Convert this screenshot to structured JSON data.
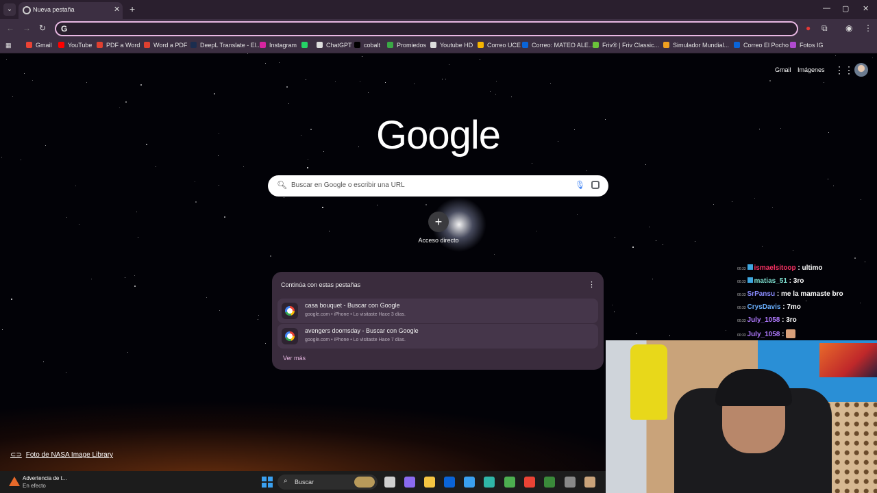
{
  "browser": {
    "tab_title": "Nueva pestaña",
    "tab_close": "✕",
    "new_tab": "+",
    "window_controls": [
      "—",
      "▢",
      "✕"
    ],
    "omnibox_value": ""
  },
  "bookmarks": [
    {
      "label": "Gmail",
      "color": "#ea4335"
    },
    {
      "label": "YouTube",
      "color": "#ff0000"
    },
    {
      "label": "PDF a Word",
      "color": "#e04030"
    },
    {
      "label": "Word a PDF",
      "color": "#e04030"
    },
    {
      "label": "DeepL Translate - El...",
      "color": "#1b2d4f"
    },
    {
      "label": "Instagram",
      "color": "#d6249f"
    },
    {
      "label": "",
      "color": "#25d366"
    },
    {
      "label": "ChatGPT",
      "color": "#dddddd"
    },
    {
      "label": "cobalt",
      "color": "#000000"
    },
    {
      "label": "Promiedos",
      "color": "#3aa845"
    },
    {
      "label": "Youtube HD",
      "color": "#dddddd"
    },
    {
      "label": "Correo UCE",
      "color": "#f5b400"
    },
    {
      "label": "Correo: MATEO ALE...",
      "color": "#0a64d8"
    },
    {
      "label": "Friv® | Friv Classic...",
      "color": "#6ac23a"
    },
    {
      "label": "Simulador Mundial...",
      "color": "#f0a020"
    },
    {
      "label": "Correo El Pocho",
      "color": "#0a64d8"
    },
    {
      "label": "Fotos IG",
      "color": "#b04ad0"
    }
  ],
  "ntp": {
    "top_links": {
      "gmail": "Gmail",
      "images": "Imágenes"
    },
    "logo": "Google",
    "search_placeholder": "Buscar en Google o escribir una URL",
    "shortcut": {
      "plus": "+",
      "label": "Acceso directo"
    },
    "continue_card": {
      "heading": "Continúa con estas pestañas",
      "menu": "⋮",
      "items": [
        {
          "title": "casa bouquet - Buscar con Google",
          "subtitle": "google.com • iPhone • Lo visitaste Hace 3 días."
        },
        {
          "title": "avengers doomsday - Buscar con Google",
          "subtitle": "google.com • iPhone • Lo visitaste Hace 7 días."
        }
      ],
      "more": "Ver más"
    },
    "credit": "Foto de NASA Image Library"
  },
  "chat": [
    {
      "time": "00:33",
      "user": "ismaelsitoop",
      "user_color": "#ff3366",
      "text": " : ultimo",
      "badge": true
    },
    {
      "time": "00:33",
      "user": "matias_51",
      "user_color": "#7fe0d0",
      "text": " : 3ro",
      "badge": true
    },
    {
      "time": "00:33",
      "user": "SrPansu",
      "user_color": "#8a8cff",
      "text": " : me la mamaste bro",
      "badge": false
    },
    {
      "time": "00:33",
      "user": "CrysDavis",
      "user_color": "#6ab0ff",
      "text": " : 7mo",
      "badge": false
    },
    {
      "time": "00:33",
      "user": "July_1058",
      "user_color": "#b07aff",
      "text": " : 3ro",
      "badge": false
    },
    {
      "time": "00:33",
      "user": "July_1058",
      "user_color": "#b07aff",
      "text": " : ",
      "badge": false,
      "emote": true
    }
  ],
  "taskbar": {
    "warning_title": "Advertencia de t...",
    "warning_sub": "En efecto",
    "search": "Buscar",
    "apps": [
      {
        "name": "task-view",
        "color": "#cfcfcf"
      },
      {
        "name": "copilot",
        "color": "#8a6af0"
      },
      {
        "name": "file-explorer",
        "color": "#f5c542"
      },
      {
        "name": "outlook",
        "color": "#0a64d8"
      },
      {
        "name": "ms-store",
        "color": "#3aa0f0"
      },
      {
        "name": "edge",
        "color": "#2fb6a8"
      },
      {
        "name": "utorrent",
        "color": "#4caf50"
      },
      {
        "name": "chrome",
        "color": "#ea4335"
      },
      {
        "name": "minecraft",
        "color": "#3a8a3a"
      },
      {
        "name": "obs",
        "color": "#888888"
      },
      {
        "name": "avatar",
        "color": "#c9a37a"
      }
    ]
  }
}
